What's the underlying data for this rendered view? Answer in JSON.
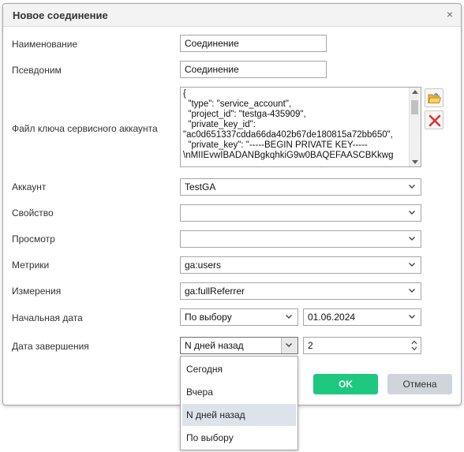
{
  "dialog": {
    "title": "Новое соединение",
    "close_glyph": "×"
  },
  "labels": {
    "name": "Наименование",
    "alias": "Псевдоним",
    "key_file": "Файл ключа сервисного аккаунта",
    "account": "Аккаунт",
    "property": "Свойство",
    "view": "Просмотр",
    "metrics": "Метрики",
    "dimensions": "Измерения",
    "start_date": "Начальная дата",
    "end_date": "Дата завершения"
  },
  "fields": {
    "name": "Соединение",
    "alias": "Соединение",
    "key_lines": [
      "{",
      "  \"type\": \"service_account\",",
      "  \"project_id\": \"testga-435909\",",
      "  \"private_key_id\":",
      "\"ac0d651337cdda66da402b67de180815a72bb650\",",
      "  \"private_key\": \"-----BEGIN PRIVATE KEY-----",
      "\\nMIIEvwIBADANBgkqhkiG9w0BAQEFAASCBKkwg"
    ],
    "account": "TestGA",
    "property": "",
    "view": "",
    "metrics": "ga:users",
    "dimensions": "ga:fullReferrer",
    "start_mode": "По выбору",
    "start_date": "01.06.2024",
    "end_mode": "N дней назад",
    "end_days": "2"
  },
  "icons": {
    "open": "folder-open-icon",
    "delete": "delete-x-icon",
    "chevron": "chevron-down-icon"
  },
  "buttons": {
    "ok": "OK",
    "cancel": "Отмена"
  },
  "colors": {
    "ok": "#1ec97f",
    "cancel": "#d0d5db",
    "selected_option": "#dde3ea"
  },
  "dropdown": {
    "options": [
      "Сегодня",
      "Вчера",
      "N дней назад",
      "По выбору"
    ],
    "selected": "N дней назад"
  }
}
